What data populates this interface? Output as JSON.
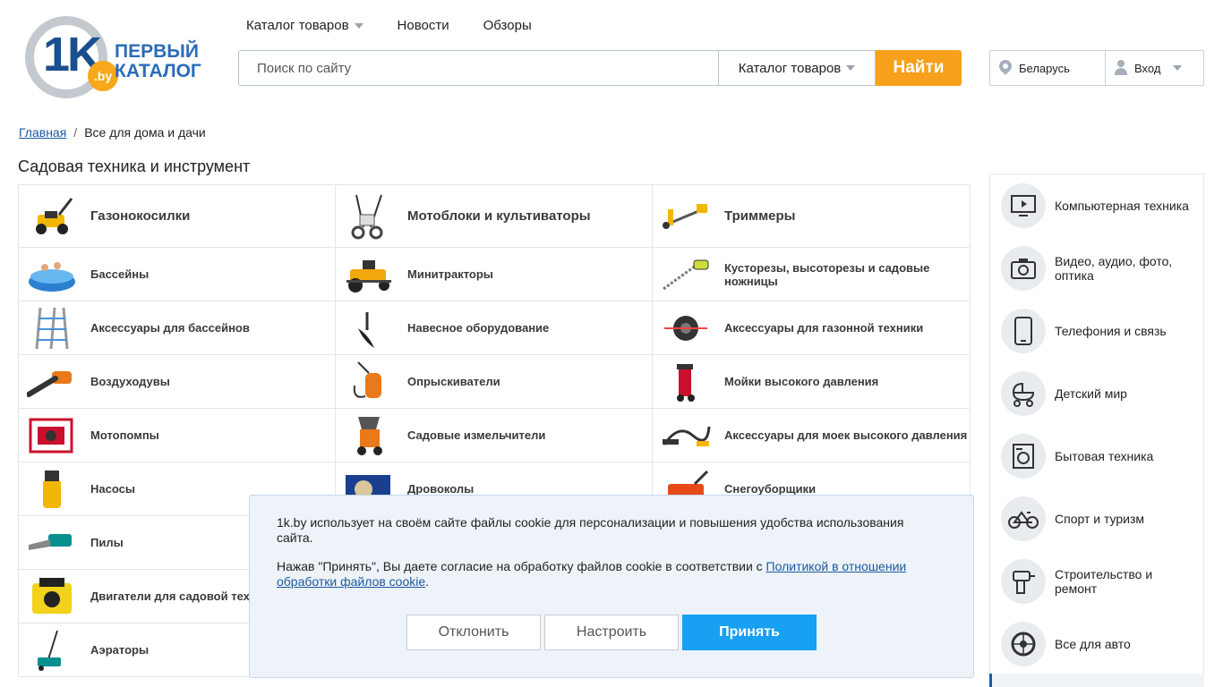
{
  "logo": {
    "mark": "1K",
    "domain": ".by",
    "line1": "ПЕРВЫЙ",
    "line2": "КАТАЛОГ"
  },
  "nav": {
    "catalog": "Каталог товаров",
    "news": "Новости",
    "reviews": "Обзоры"
  },
  "search": {
    "placeholder": "Поиск по сайту",
    "category": "Каталог товаров",
    "button": "Найти"
  },
  "region": {
    "country": "Беларусь",
    "login": "Вход"
  },
  "breadcrumb": {
    "home": "Главная",
    "separator": "/",
    "current": "Все для дома и дачи"
  },
  "page_title": "Садовая техника и инструмент",
  "categories": [
    {
      "label": "Газонокосилки",
      "icon": "lawn-mower-icon"
    },
    {
      "label": "Мотоблоки и культиваторы",
      "icon": "cultivator-icon"
    },
    {
      "label": "Триммеры",
      "icon": "trimmer-icon"
    },
    {
      "label": "Бассейны",
      "icon": "pool-icon"
    },
    {
      "label": "Минитракторы",
      "icon": "mini-tractor-icon"
    },
    {
      "label": "Кусторезы, высоторезы и садовые ножницы",
      "icon": "hedge-trimmer-icon"
    },
    {
      "label": "Аксессуары для бассейнов",
      "icon": "pool-ladder-icon"
    },
    {
      "label": "Навесное оборудование",
      "icon": "plough-icon"
    },
    {
      "label": "Аксессуары для газонной техники",
      "icon": "trimmer-spool-icon"
    },
    {
      "label": "Воздуходувы",
      "icon": "leaf-blower-icon"
    },
    {
      "label": "Опрыскиватели",
      "icon": "sprayer-icon"
    },
    {
      "label": "Мойки высокого давления",
      "icon": "pressure-washer-icon"
    },
    {
      "label": "Мотопомпы",
      "icon": "motor-pump-icon"
    },
    {
      "label": "Садовые измельчители",
      "icon": "shredder-icon"
    },
    {
      "label": "Аксессуары для моек высокого давления",
      "icon": "washer-hose-icon"
    },
    {
      "label": "Насосы",
      "icon": "pump-icon"
    },
    {
      "label": "Дровоколы",
      "icon": "log-splitter-icon"
    },
    {
      "label": "Снегоуборщики",
      "icon": "snow-blower-icon"
    },
    {
      "label": "Пилы",
      "icon": "saw-icon"
    },
    {
      "label": "",
      "icon": ""
    },
    {
      "label": "",
      "icon": ""
    },
    {
      "label": "Двигатели для садовой техники",
      "icon": "engine-icon"
    },
    {
      "label": "",
      "icon": ""
    },
    {
      "label": "",
      "icon": ""
    },
    {
      "label": "Аэраторы",
      "icon": "aerator-icon"
    },
    {
      "label": "",
      "icon": ""
    },
    {
      "label": "",
      "icon": ""
    }
  ],
  "sidebar": [
    {
      "label": "Компьютерная техника",
      "icon": "monitor-icon"
    },
    {
      "label": "Видео, аудио, фото, оптика",
      "icon": "camera-icon"
    },
    {
      "label": "Телефония и связь",
      "icon": "phone-icon"
    },
    {
      "label": "Детский мир",
      "icon": "stroller-icon"
    },
    {
      "label": "Бытовая техника",
      "icon": "washing-machine-icon"
    },
    {
      "label": "Спорт и туризм",
      "icon": "bicycle-icon"
    },
    {
      "label": "Строительство и ремонт",
      "icon": "drill-icon"
    },
    {
      "label": "Все для авто",
      "icon": "wheel-icon"
    }
  ],
  "cookie": {
    "text1": "1k.by использует на своём сайте файлы cookie для персонализации и повышения удобства использования сайта.",
    "text2_prefix": "Нажав \"Принять\", Вы даете согласие на обработку файлов cookie в соответствии с ",
    "policy_link": "Политикой в отношении обработки файлов cookie",
    "text2_suffix": ".",
    "decline": "Отклонить",
    "configure": "Настроить",
    "accept": "Принять"
  },
  "colors": {
    "accent": "#f7a01b",
    "link": "#1a5aa0",
    "accept": "#18a0f2",
    "brand": "#2b6cb8"
  }
}
